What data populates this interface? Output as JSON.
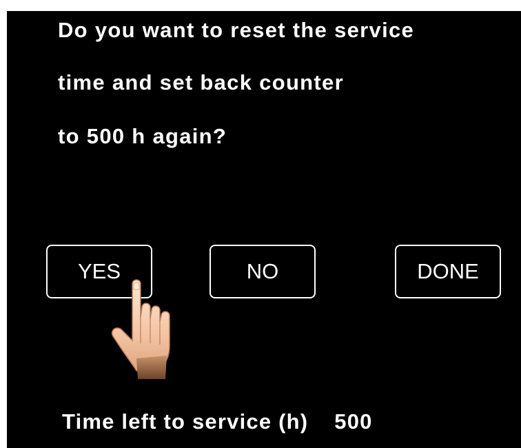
{
  "dialog": {
    "question_lines": [
      "Do you want to reset the service",
      "time and set back counter",
      "to 500 h again?"
    ]
  },
  "buttons": {
    "yes_label": "YES",
    "no_label": "NO",
    "done_label": "DONE"
  },
  "status": {
    "label": "Time left to service (h)",
    "value": "500"
  },
  "pointer": {
    "icon": "pointing-hand-icon",
    "target": "YES"
  },
  "colors": {
    "background": "#000000",
    "foreground": "#ffffff",
    "hand_skin": "#f5ccb0",
    "hand_shadow": "#8a5a38"
  }
}
